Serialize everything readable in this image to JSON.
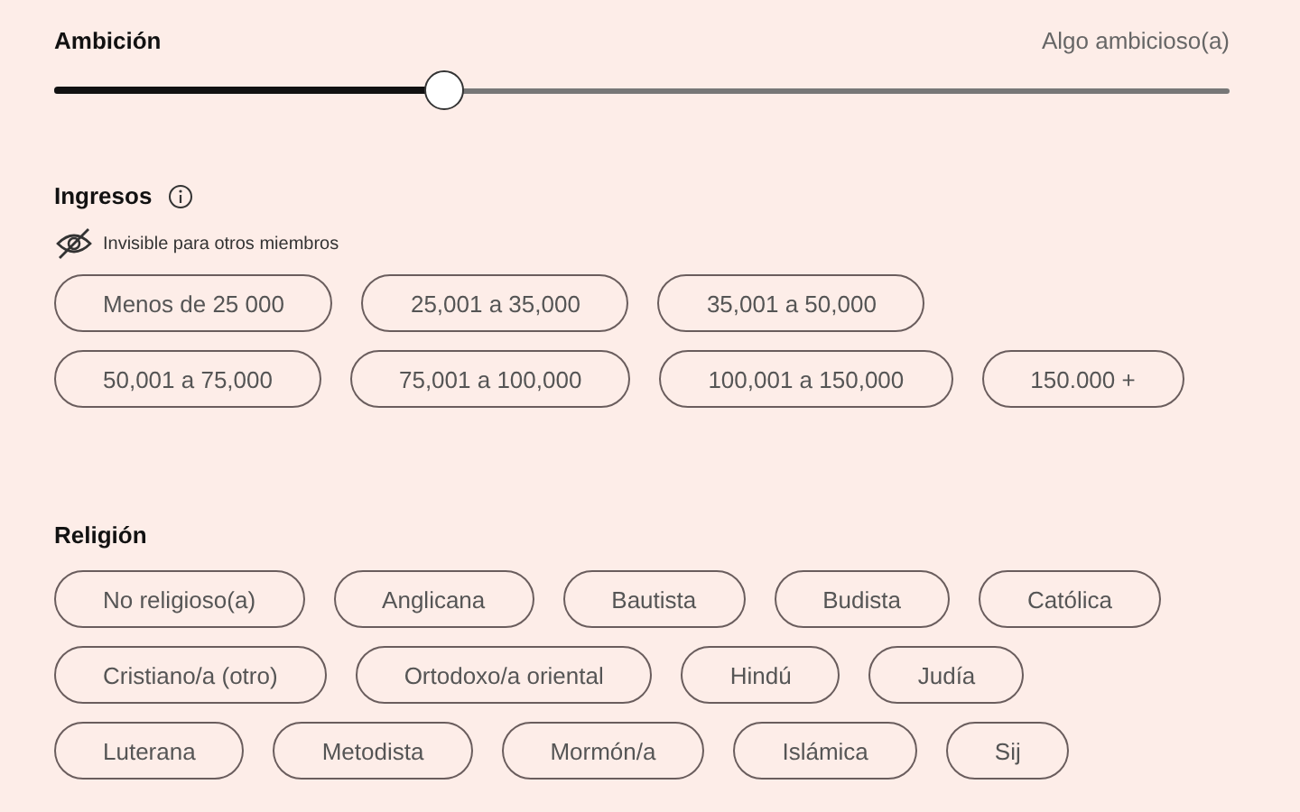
{
  "ambition": {
    "title": "Ambición",
    "reading": "Algo ambicioso(a)",
    "level": 0.333
  },
  "income": {
    "title": "Ingresos",
    "privacy_note": "Invisible para otros miembros",
    "rows": [
      [
        {
          "label": "Menos de 25 000",
          "selected": false
        },
        {
          "label": "25,001 a 35,000",
          "selected": false
        },
        {
          "label": "35,001 a 50,000",
          "selected": false
        }
      ],
      [
        {
          "label": "50,001 a 75,000",
          "selected": false
        },
        {
          "label": "75,001 a 100,000",
          "selected": false
        },
        {
          "label": "100,001 a 150,000",
          "selected": false
        },
        {
          "label": "150.000 +",
          "selected": false
        }
      ]
    ]
  },
  "religion": {
    "title": "Religión",
    "rows": [
      [
        {
          "label": "No religioso(a)",
          "selected": false
        },
        {
          "label": "Anglicana",
          "selected": false
        },
        {
          "label": "Bautista",
          "selected": false
        },
        {
          "label": "Budista",
          "selected": false
        },
        {
          "label": "Católica",
          "selected": false
        }
      ],
      [
        {
          "label": "Cristiano/a (otro)",
          "selected": false
        },
        {
          "label": "Ortodoxo/a oriental",
          "selected": false
        },
        {
          "label": "Hindú",
          "selected": false
        },
        {
          "label": "Judía",
          "selected": false
        }
      ],
      [
        {
          "label": "Luterana",
          "selected": false
        },
        {
          "label": "Metodista",
          "selected": false
        },
        {
          "label": "Mormón/a",
          "selected": false
        },
        {
          "label": "Islámica",
          "selected": false
        },
        {
          "label": "Sij",
          "selected": false
        }
      ]
    ]
  }
}
